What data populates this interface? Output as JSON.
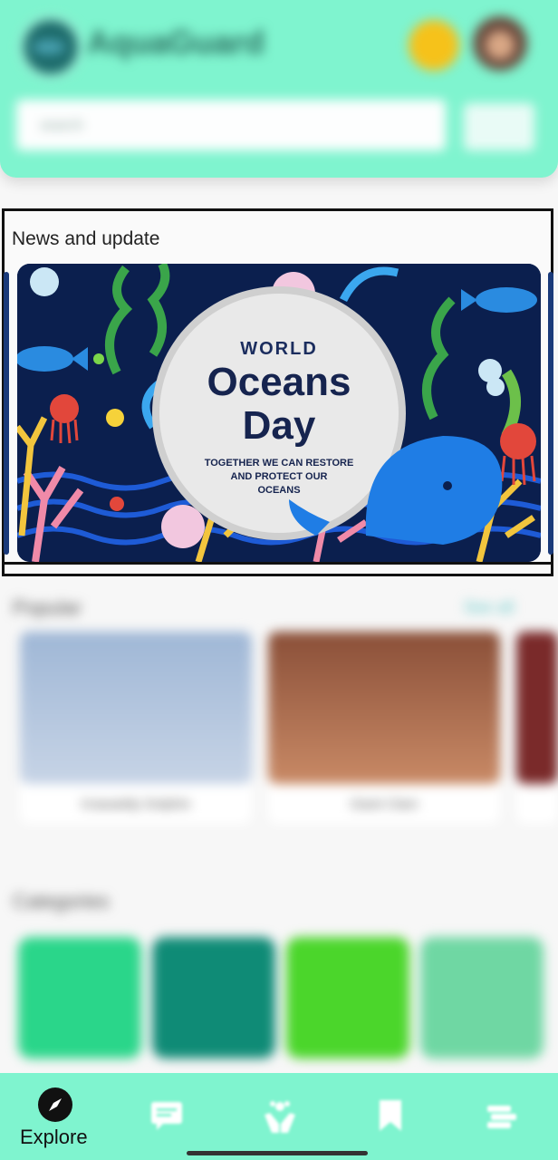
{
  "header": {
    "app_title": "AquaGuard",
    "search_placeholder": "search"
  },
  "news": {
    "title": "News and update",
    "banner": {
      "line1": "WORLD",
      "line2": "Oceans",
      "line3": "Day",
      "tagline1": "TOGETHER WE CAN RESTORE",
      "tagline2": "AND PROTECT OUR",
      "tagline3": "OCEANS"
    }
  },
  "popular": {
    "title": "Popular",
    "see_all": "See all",
    "items": [
      {
        "label": "Irrawaddy Dolphin"
      },
      {
        "label": "Giant Clam"
      }
    ]
  },
  "categories": {
    "title": "Categories"
  },
  "nav": {
    "items": [
      {
        "label": "Explore",
        "icon": "compass-icon",
        "active": true
      },
      {
        "label": "",
        "icon": "chat-icon"
      },
      {
        "label": "",
        "icon": "care-hands-icon"
      },
      {
        "label": "",
        "icon": "bookmark-icon"
      },
      {
        "label": "",
        "icon": "books-icon"
      }
    ]
  },
  "colors": {
    "accent": "#7ff4cf"
  }
}
